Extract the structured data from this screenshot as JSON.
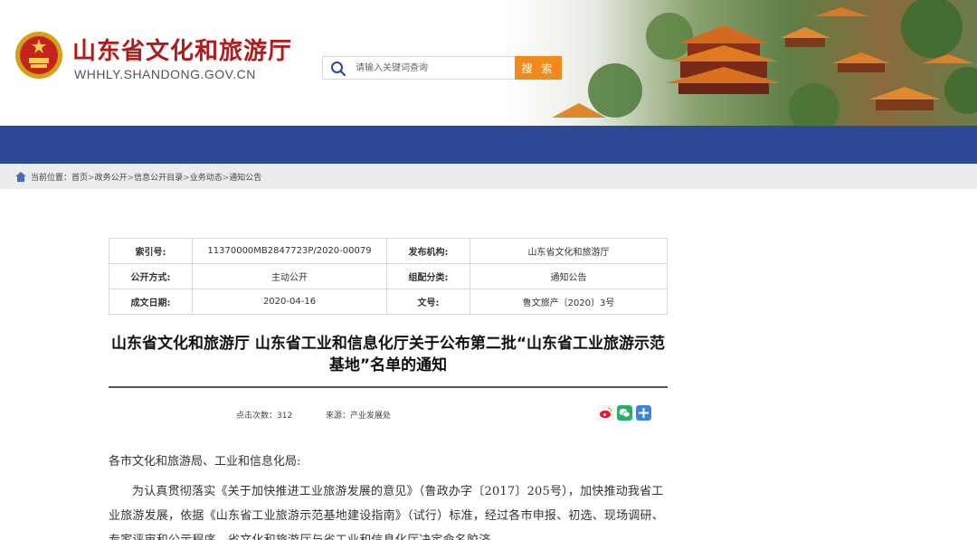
{
  "header": {
    "site_title": "山东省文化和旅游厅",
    "site_domain": "WHHLY.SHANDONG.GOV.CN"
  },
  "search": {
    "placeholder": "请输入关键词查询",
    "button_label": "搜 索"
  },
  "breadcrumb": {
    "prefix": "当前位置：",
    "items": [
      "首页",
      "政务公开",
      "信息公开目录",
      "业务动态",
      "通知公告"
    ]
  },
  "meta": {
    "index_label": "索引号:",
    "index_value": "11370000MB2847723P/2020-00079",
    "publisher_label": "发布机构:",
    "publisher_value": "山东省文化和旅游厅",
    "disclosure_label": "公开方式:",
    "disclosure_value": "主动公开",
    "category_label": "组配分类:",
    "category_value": "通知公告",
    "date_label": "成文日期:",
    "date_value": "2020-04-16",
    "doc_no_label": "文号:",
    "doc_no_value": "鲁文旅产〔2020〕3号"
  },
  "article": {
    "title": "山东省文化和旅游厅 山东省工业和信息化厅关于公布第二批“山东省工业旅游示范基地”名单的通知",
    "clicks": "点击次数：312",
    "source": "来源：产业发展处",
    "greeting": "各市文化和旅游局、工业和信息化局:",
    "paragraph": "为认真贯彻落实《关于加快推进工业旅游发展的意见》（鲁政办字〔2017〕205号），加快推动我省工业旅游发展，依据《山东省工业旅游示范基地建设指南》（试行）标准，经过各市申报、初选、现场调研、专家评审和公示程序，省文化和旅游厅与省工业和信息化厅决定命名胶济"
  },
  "colors": {
    "title_red": "#b31b1b",
    "nav_blue": "#2c4a93",
    "search_orange": "#f08a1c"
  },
  "icons": [
    "national-emblem-icon",
    "search-icon",
    "home-icon",
    "weibo-icon",
    "wechat-icon",
    "more-share-icon"
  ]
}
